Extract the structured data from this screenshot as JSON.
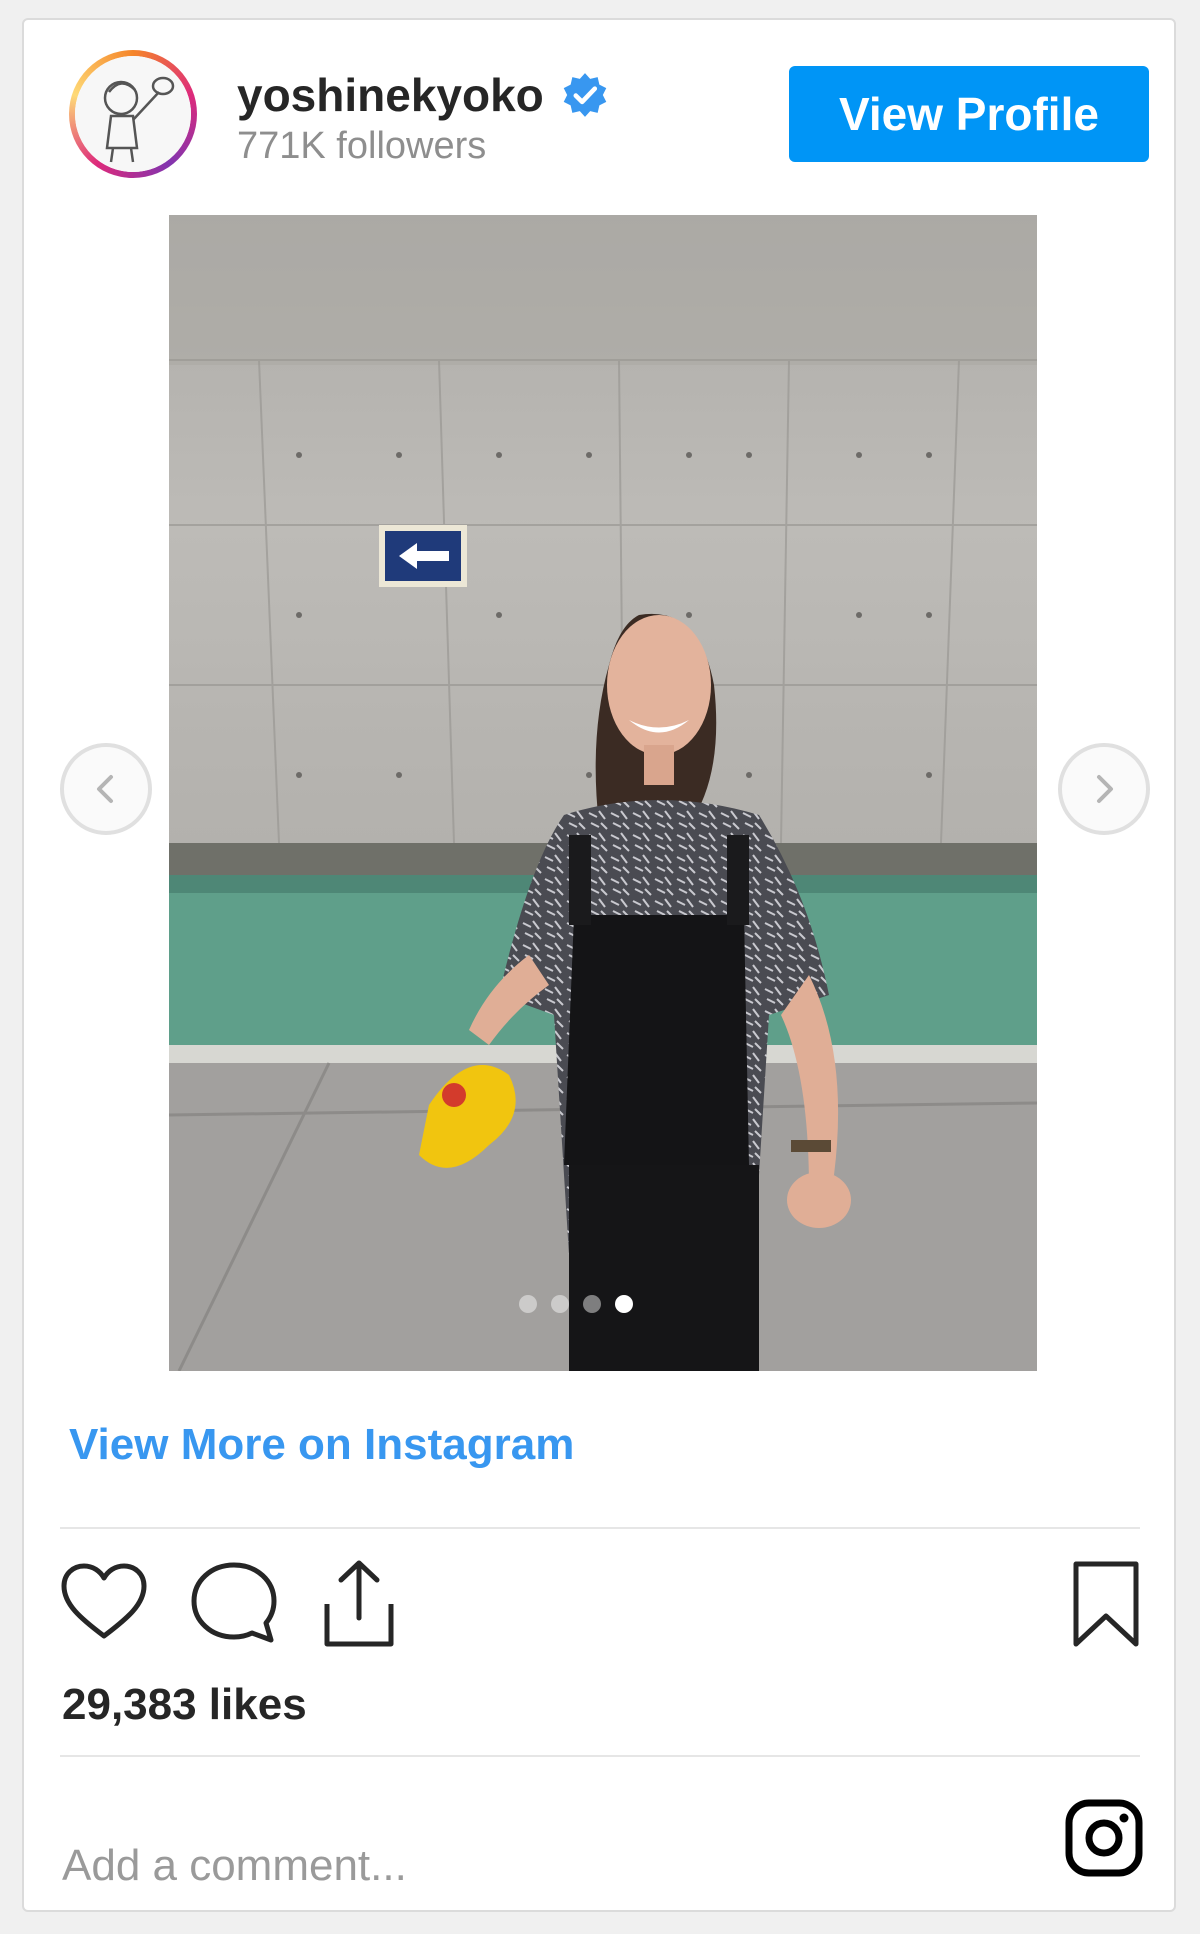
{
  "header": {
    "username": "yoshinekyoko",
    "followers": "771K followers",
    "view_profile_label": "View Profile"
  },
  "carousel": {
    "slide_count": 4,
    "active_slide": 4
  },
  "links": {
    "view_more": "View More on Instagram"
  },
  "engagement": {
    "likes": "29,383 likes"
  },
  "comment": {
    "placeholder": "Add a comment..."
  },
  "icons": {
    "verified": "verified-badge-icon",
    "like": "heart-icon",
    "comment": "comment-bubble-icon",
    "share": "share-icon",
    "save": "bookmark-icon",
    "prev": "chevron-left-icon",
    "next": "chevron-right-icon",
    "logo": "instagram-logo-icon"
  },
  "colors": {
    "accent": "#0095f6",
    "link": "#3897f0",
    "text": "#262626",
    "muted": "#8e8e8e",
    "verified": "#3897f0"
  }
}
